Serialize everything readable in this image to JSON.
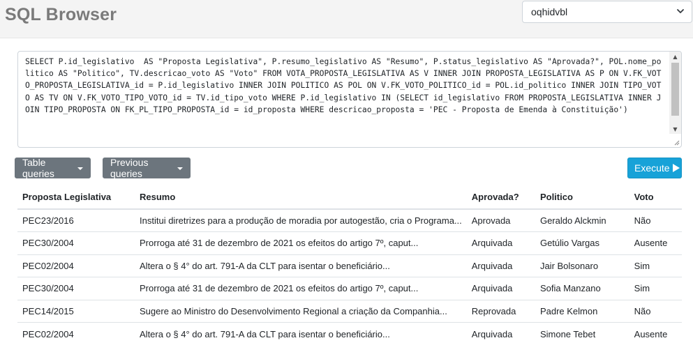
{
  "app": {
    "title": "SQL Browser"
  },
  "database_select": {
    "selected": "oqhidvbl"
  },
  "query": {
    "text": "SELECT P.id_legislativo  AS \"Proposta Legislativa\", P.resumo_legislativo AS \"Resumo\", P.status_legislativo AS \"Aprovada?\", POL.nome_politico AS \"Politico\", TV.descricao_voto AS \"Voto\" FROM VOTA_PROPOSTA_LEGISLATIVA AS V INNER JOIN PROPOSTA_LEGISLATIVA AS P ON V.FK_VOTO_PROPOSTA_LEGISLATIVA_id = P.id_legislativo INNER JOIN POLITICO AS POL ON V.FK_VOTO_POLITICO_id = POL.id_politico INNER JOIN TIPO_VOTO AS TV ON V.FK_VOTO_TIPO_VOTO_id = TV.id_tipo_voto WHERE P.id_legislativo IN (SELECT id_legislativo FROM PROPOSTA_LEGISLATIVA INNER JOIN TIPO_PROPOSTA ON FK_PL_TIPO_PROPOSTA_id = id_proposta WHERE descricao_proposta = 'PEC - Proposta de Emenda à Constituição')"
  },
  "toolbar": {
    "table_queries_label": "Table queries",
    "previous_queries_label": "Previous queries",
    "execute_label": "Execute"
  },
  "results": {
    "columns": [
      "Proposta Legislativa",
      "Resumo",
      "Aprovada?",
      "Politico",
      "Voto"
    ],
    "rows": [
      [
        "PEC23/2016",
        "Institui diretrizes para a produção de moradia por autogestão, cria o Programa...",
        "Aprovada",
        "Geraldo Alckmin",
        "Não"
      ],
      [
        "PEC30/2004",
        "Prorroga até 31 de dezembro de 2021 os efeitos do artigo 7º, caput...",
        "Arquivada",
        "Getúlio Vargas",
        "Ausente"
      ],
      [
        "PEC02/2004",
        "Altera o § 4° do art. 791-A da CLT para isentar o beneficiário...",
        "Arquivada",
        "Jair Bolsonaro",
        "Sim"
      ],
      [
        "PEC30/2004",
        "Prorroga até 31 de dezembro de 2021 os efeitos do artigo 7º, caput...",
        "Arquivada",
        "Sofia Manzano",
        "Sim"
      ],
      [
        "PEC14/2015",
        "Sugere ao Ministro do Desenvolvimento Regional a criação da Companhia...",
        "Reprovada",
        "Padre Kelmon",
        "Não"
      ],
      [
        "PEC02/2004",
        "Altera o § 4° do art. 791-A da CLT para isentar o beneficiário...",
        "Arquivada",
        "Simone Tebet",
        "Ausente"
      ]
    ]
  },
  "colors": {
    "primary": "#17a2d8",
    "secondary": "#6c757d",
    "title_gray": "#7a7a7a"
  },
  "icons": {
    "select_chevron": "chevron-down-icon",
    "execute": "play-icon",
    "dropdown_caret": "caret-down-icon"
  }
}
